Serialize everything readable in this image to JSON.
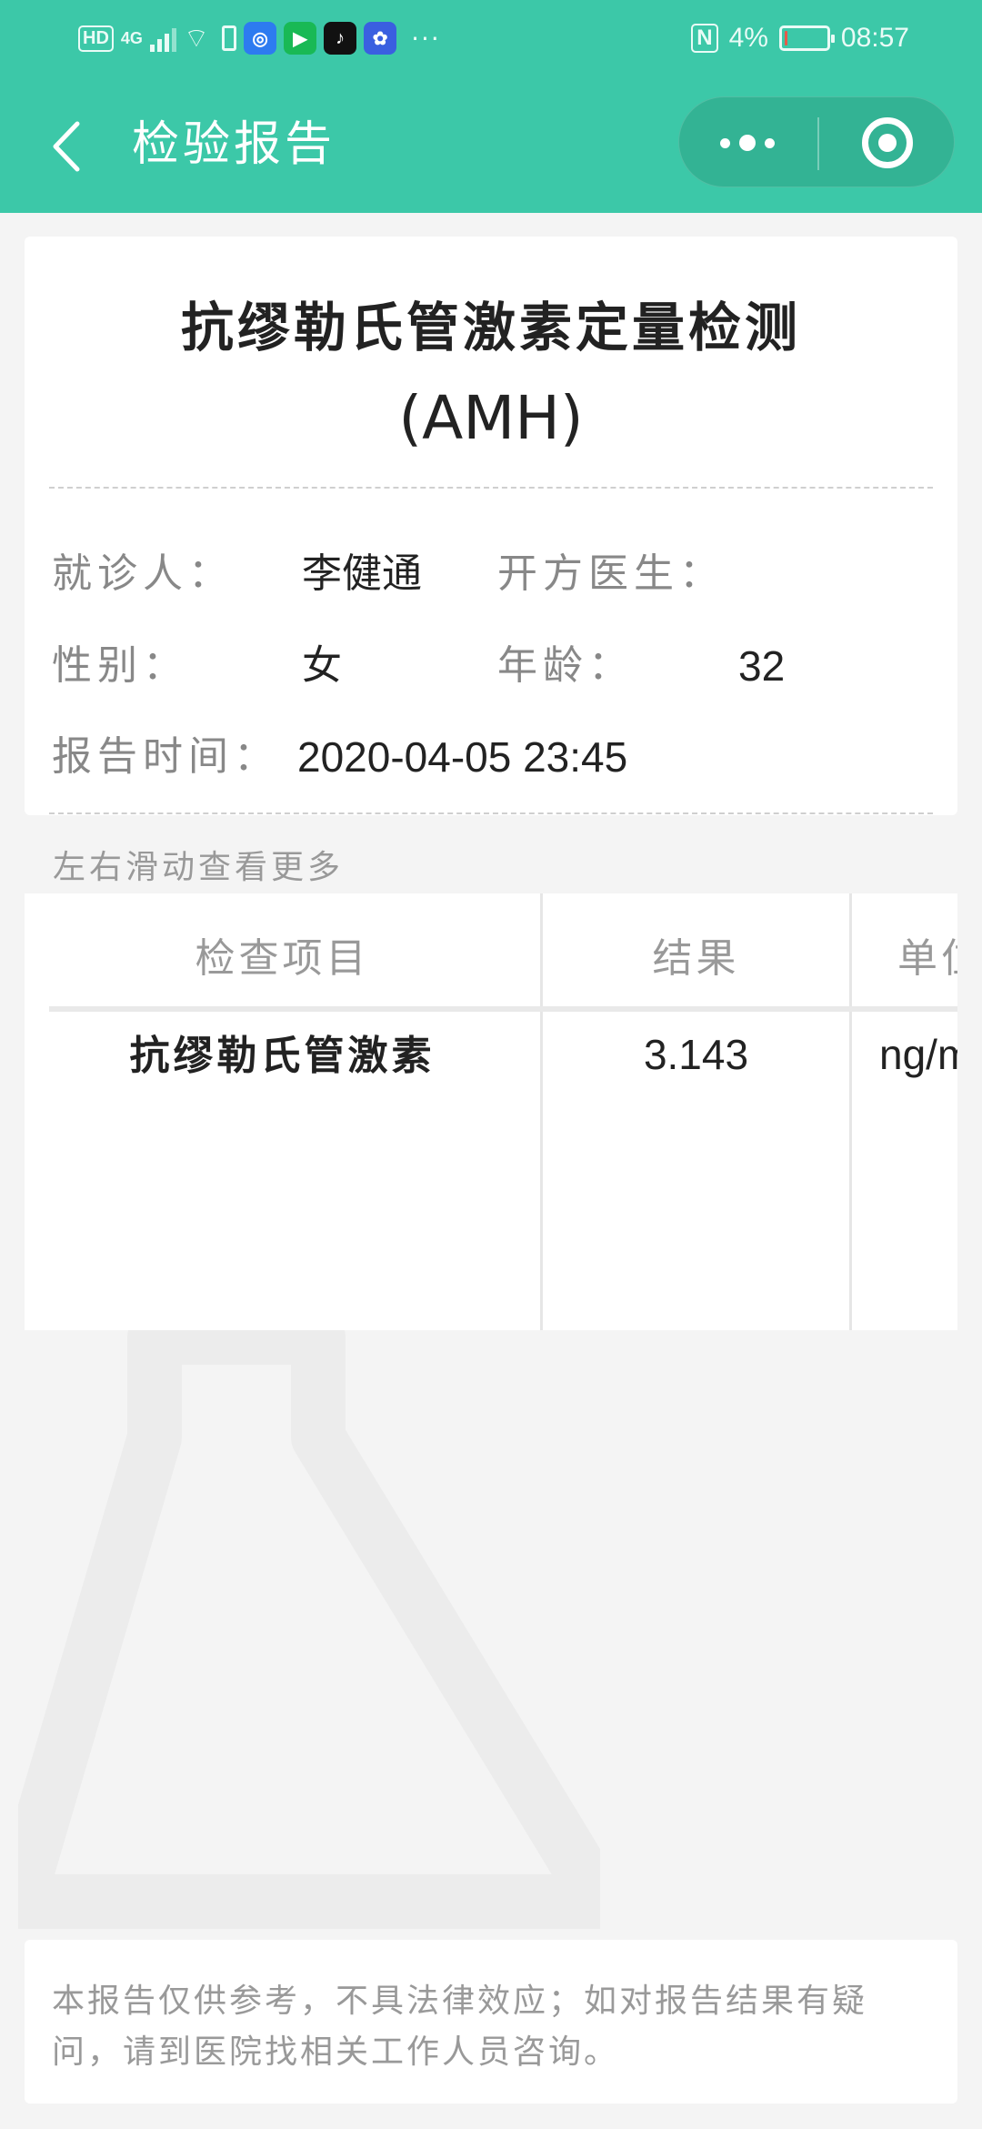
{
  "status_bar": {
    "hd": "HD",
    "network": "4G",
    "nfc": "N",
    "battery": "4%",
    "battery_level": 0.04,
    "time": "08:57",
    "app_icons": [
      "browser-icon",
      "video-icon",
      "tiktok-icon",
      "baidu-icon"
    ]
  },
  "nav": {
    "title": "检验报告"
  },
  "report": {
    "test_name": "抗缪勒氏管激素定量检测",
    "test_code": "(AMH)",
    "patient_label": "就诊人：",
    "patient_name": "李健通",
    "doctor_label": "开方医生：",
    "doctor_name": "",
    "gender_label": "性别：",
    "gender": "女",
    "age_label": "年龄：",
    "age": "32",
    "time_label": "报告时间：",
    "report_time": "2020-04-05 23:45"
  },
  "hint": "左右滑动查看更多",
  "table": {
    "headers": [
      "检查项目",
      "结果",
      "单位"
    ],
    "rows": [
      {
        "item": "抗缪勒氏管激素",
        "result": "3.143",
        "unit": "ng/ml"
      }
    ]
  },
  "disclaimer": "本报告仅供参考，不具法律效应；如对报告结果有疑问，请到医院找相关工作人员咨询。",
  "colors": {
    "theme": "#3cc8a8",
    "background": "#f4f4f4"
  }
}
